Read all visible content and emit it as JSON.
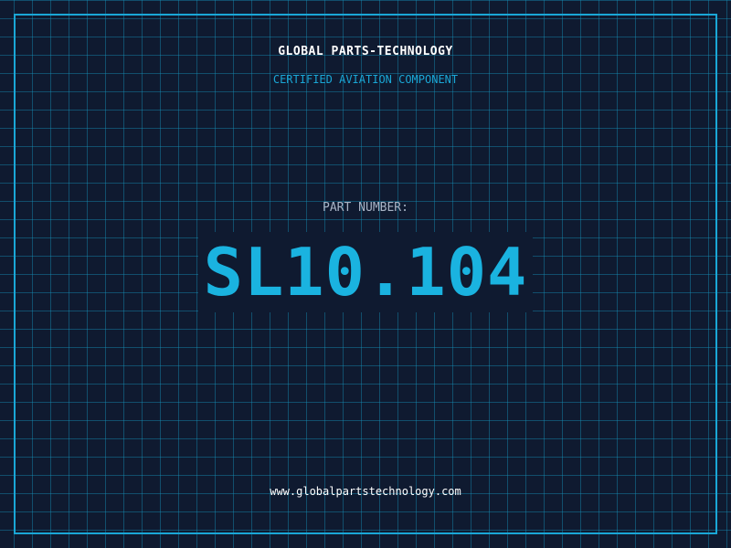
{
  "header": {
    "company": "GLOBAL PARTS-TECHNOLOGY",
    "tagline": "CERTIFIED AVIATION COMPONENT"
  },
  "part": {
    "label": "PART NUMBER:",
    "number": "SL10.104"
  },
  "footer": {
    "website": "www.globalpartstechnology.com"
  },
  "colors": {
    "background": "#0f1a30",
    "grid": "#1496be",
    "accent": "#1ab3e0",
    "label": "#a9b4c6",
    "text": "#ffffff"
  }
}
